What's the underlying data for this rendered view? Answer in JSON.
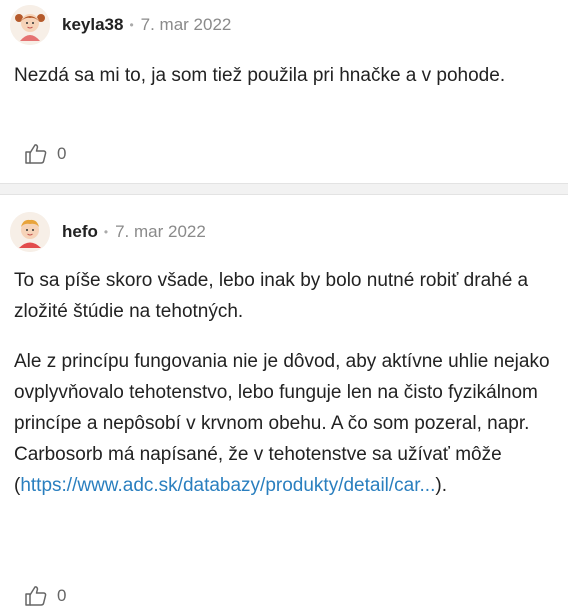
{
  "posts": [
    {
      "username": "keyla38",
      "separator_dot": "•",
      "date": "7. mar 2022",
      "paragraphs": [
        "Nezdá sa mi to, ja som tiež použila pri hnačke a v pohode."
      ],
      "likes": "0",
      "avatar_icon": "girl-avatar-icon"
    },
    {
      "username": "hefo",
      "separator_dot": "•",
      "date": "7. mar 2022",
      "paragraphs": [
        "To sa píše skoro všade, lebo inak by bolo nutné robiť drahé a zložité štúdie na tehotných.",
        "Ale z princípu fungovania nie je dôvod, aby aktívne uhlie nejako ovplyvňovalo tehotenstvo, lebo funguje len na čisto fyzikálnom princípe a nepôsobí v krvnom obehu. A čo som pozeral, napr. Carbosorb má napísané, že v tehotenstve sa užívať môže"
      ],
      "link_prefix": "(",
      "link_text": "https://www.adc.sk/databazy/produkty/detail/car...",
      "link_suffix": ").",
      "likes": "0",
      "avatar_icon": "boy-avatar-icon"
    }
  ],
  "colors": {
    "link": "#2a7fbf",
    "date": "#8a8a8a",
    "separator_bg": "#f2f2f2",
    "avatar_skin": "#f6d3b8",
    "avatar_hair_girl": "#b55a2b",
    "avatar_hair_boy": "#e8a43c",
    "avatar_shirt_girl": "#e57373",
    "avatar_shirt_boy": "#e24b4b"
  }
}
